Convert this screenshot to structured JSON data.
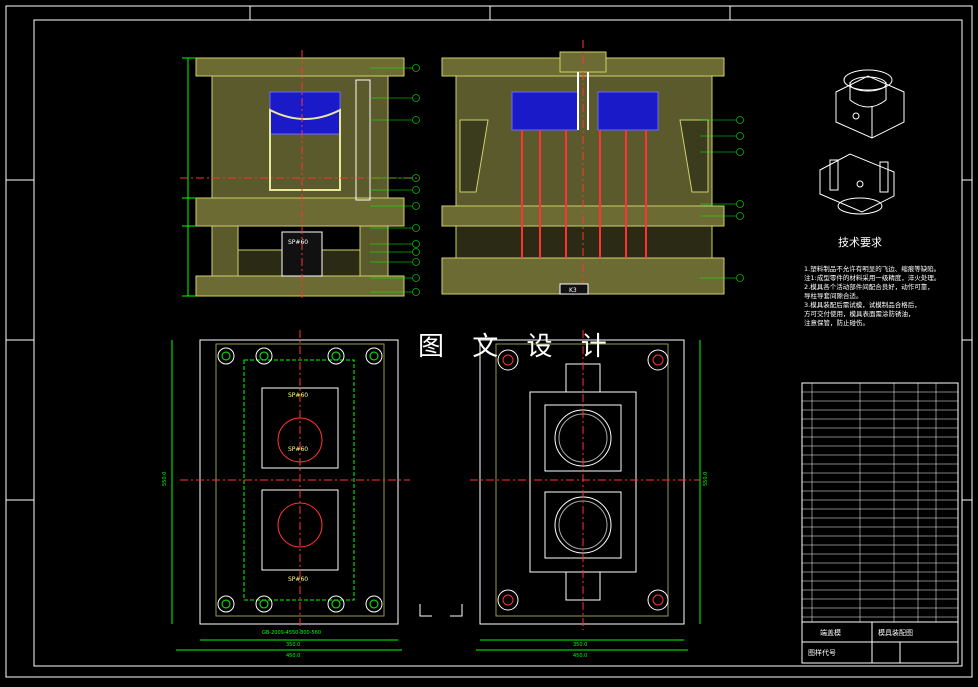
{
  "drawing": {
    "watermark": "图 文 设 计",
    "tech_title": "技术要求",
    "notes": [
      "1.塑料制品不允许有明显的飞边、缩痕等缺陷。",
      "注1:成型零件的材料采用一级精度，淬火处理。",
      "2.模具各个活动部件间配合良好，动作可靠，",
      "导柱导套间隙合适。",
      "3.模具装配后需试模，试模制品合格后，",
      "方可交付使用，模具表面需涂防锈油，",
      "注意保管，防止碰伤。"
    ],
    "labels": {
      "sp1": "SP#60",
      "sp2": "SP#60",
      "sp3": "SP#60",
      "sp4": "SP#60",
      "k1": "K3",
      "dim_left_bottom": "450.0",
      "dim_right_bottom": "450.0",
      "dim_left_mid": "350.0",
      "dim_right_mid": "350.0",
      "dim_left_side": "550.0",
      "dim_right_side": "550.0",
      "spec": "GB-2009-4550-800-560",
      "tb_name": "模具装配图",
      "tb_code": "图样代号",
      "tb_title": "端盖模"
    }
  },
  "colors": {
    "bg": "#000000",
    "line": "#ffffff",
    "green": "#00ff00",
    "yellow": "#ffff00",
    "olive": "#9a9a4a",
    "red": "#ff2020",
    "blue": "#2a2aff",
    "cyan": "#00ffff"
  }
}
